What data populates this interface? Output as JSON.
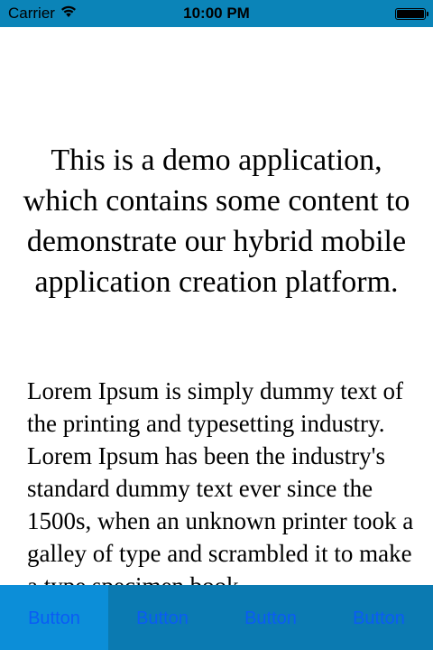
{
  "status_bar": {
    "carrier": "Carrier",
    "time": "10:00 PM",
    "signal_icon": "wifi-icon",
    "battery_icon": "battery-icon"
  },
  "main": {
    "heading": "This is a demo application, which contains some content to demonstrate our hybrid mobile application creation platform.",
    "body": "Lorem Ipsum is simply dummy text of the printing and typesetting industry. Lorem Ipsum has been the industry's standard dummy text ever since the 1500s, when an unknown printer took a galley of type and scrambled it to make a type specimen book."
  },
  "tab_bar": {
    "tabs": [
      {
        "label": "Button"
      },
      {
        "label": "Button"
      },
      {
        "label": "Button"
      },
      {
        "label": "Button"
      }
    ]
  },
  "colors": {
    "status_bar_bg": "#0b84b8",
    "tab_bar_bg": "#0b7ab1",
    "tab_active_bg": "#0c8ed8",
    "tab_text": "#0a5cf5"
  }
}
